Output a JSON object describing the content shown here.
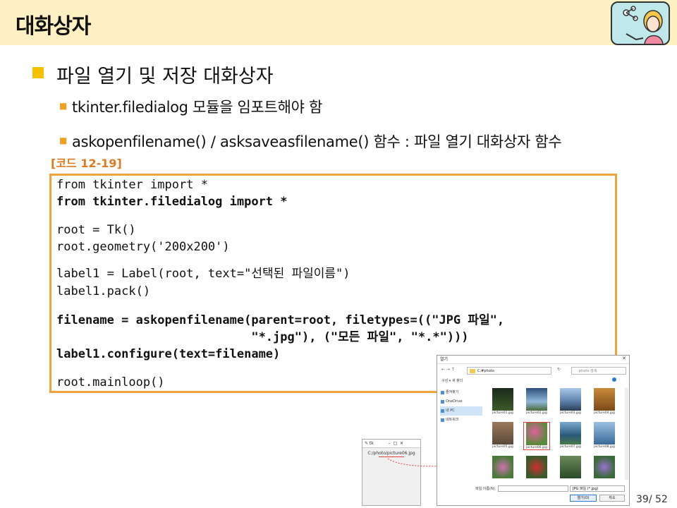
{
  "slide": {
    "title": "대화상자",
    "heading": "파일 열기 및 저장 대화상자",
    "bullets": [
      "tkinter.filedialog 모듈을 임포트해야 함",
      "askopenfilename() / asksaveasfilename()  함수 : 파일 열기 대화상자 함수"
    ],
    "code_tag": "[코드 12-19]",
    "page_number": "39/ 52"
  },
  "code": {
    "line1": "from tkinter import *",
    "line2": "from tkinter.filedialog import *",
    "line3": "root = Tk()",
    "line4": "root.geometry('200x200')",
    "line5": "label1 = Label(root, text=\"선택된 파일이름\")",
    "line6": "label1.pack()",
    "line7": "filename = askopenfilename(parent=root, filetypes=((\"JPG 파일\",",
    "line8": "                           \"*.jpg\"), (\"모든 파일\", \"*.*\")))",
    "line9": "label1.configure(text=filename)",
    "line10": "root.mainloop()"
  },
  "tk_window": {
    "label": "C:/photo/picture06.jpg"
  },
  "dialog": {
    "title": "열기",
    "address": "C:#photo",
    "search_placeholder": "photo 검색",
    "toolbar": "구성 ▾     새 폴더",
    "nav": [
      "즐겨찾기",
      "OneDrive",
      "내 PC",
      "네트워크"
    ],
    "files": [
      "picture01.jpg",
      "picture02.jpg",
      "picture03.jpg",
      "picture04.jpg",
      "picture05.jpg",
      "picture06.jpg",
      "picture07.jpg",
      "picture08.jpg",
      "",
      "",
      "",
      ""
    ],
    "filename_label": "파일 이름(N):",
    "filetype": "JPG 파일 (*.jpg)",
    "open_button": "열기(O)",
    "cancel_button": "취소"
  }
}
